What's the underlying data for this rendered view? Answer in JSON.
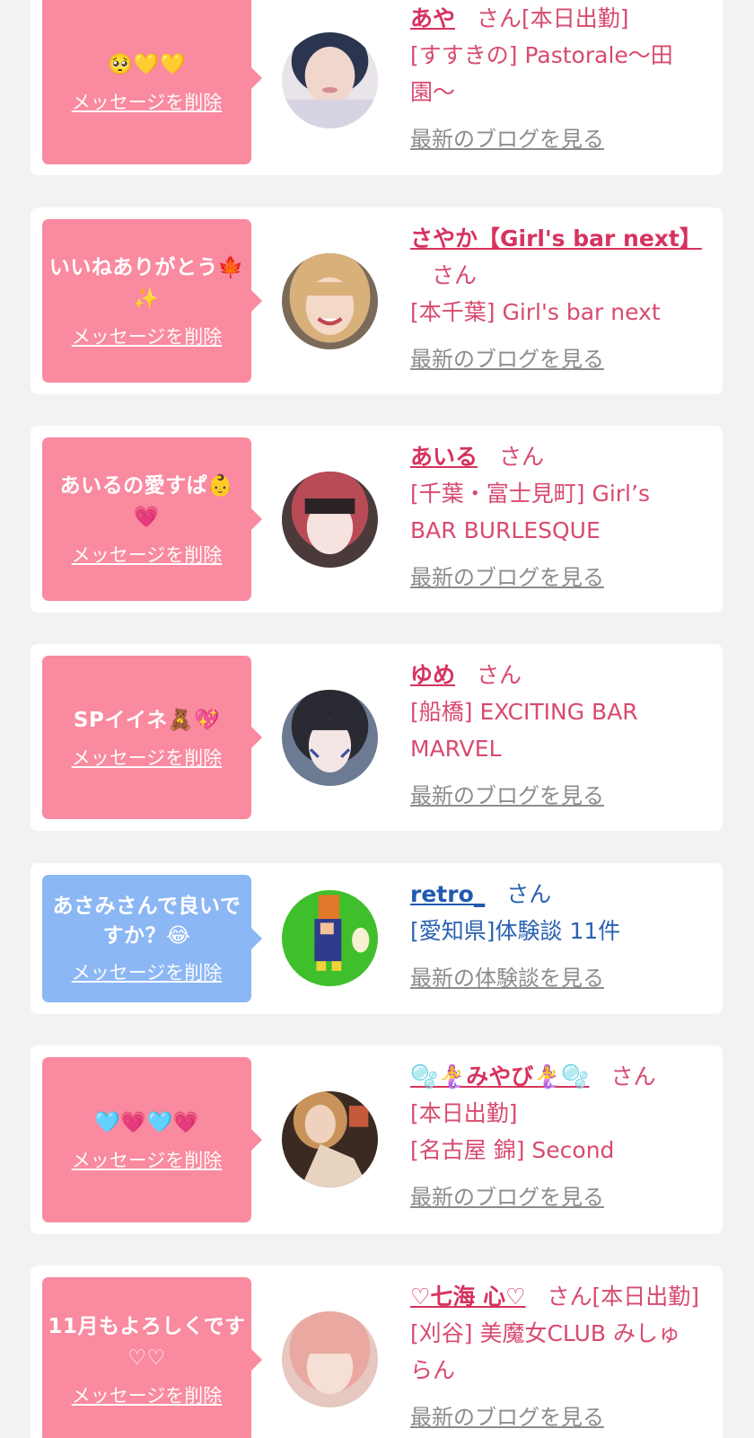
{
  "delete_label": "メッセージを削除",
  "honorific": "さん",
  "cards": [
    {
      "message": "🥺💛💛",
      "name": "あや",
      "badge": "[本日出勤]",
      "detail_lines": [
        "[すすきの] Pastorale～田",
        "園～"
      ],
      "link": "最新のブログを見る",
      "bubble_color": "#f98a9f"
    },
    {
      "message": "いいねありがとう🍁✨",
      "name": "さやか【Girl's bar next】",
      "badge": "",
      "detail_lines": [
        "[本千葉] Girl's bar next"
      ],
      "link": "最新のブログを見る",
      "bubble_color": "#f98a9f"
    },
    {
      "message": "あいるの愛すぱ👶💗",
      "name": "あいる",
      "badge": "",
      "detail_lines": [
        "[千葉・富士見町] Girl’s",
        "BAR BURLESQUE"
      ],
      "link": "最新のブログを見る",
      "bubble_color": "#f98a9f"
    },
    {
      "message": "SPイイネ🧸💖",
      "name": "ゆめ",
      "badge": "",
      "detail_lines": [
        "[船橋] EXCITING BAR",
        "MARVEL"
      ],
      "link": "最新のブログを見る",
      "bubble_color": "#f98a9f"
    },
    {
      "message": "あさみさんで良いですか？😂",
      "name": "retro_",
      "badge": "",
      "detail_lines": [
        "[愛知県]体験談 11件"
      ],
      "link": "最新の体験談を見る",
      "bubble_color": "#8cb7f5"
    },
    {
      "message": "🩵💗🩵💗",
      "name": "🫧🧜‍♀️みやび🧜‍♀️🫧",
      "badge": "",
      "detail_lines": [
        "[本日出勤]",
        "[名古屋 錦] Second"
      ],
      "link": "最新のブログを見る",
      "bubble_color": "#f98a9f"
    },
    {
      "message": "11月もよろしくです♡♡",
      "name": "♡七海 心♡",
      "badge": "[本日出勤]",
      "detail_lines": [
        "[刈谷] 美魔女CLUB みしゅ",
        "らん"
      ],
      "link": "最新のブログを見る",
      "bubble_color": "#f98a9f"
    }
  ]
}
